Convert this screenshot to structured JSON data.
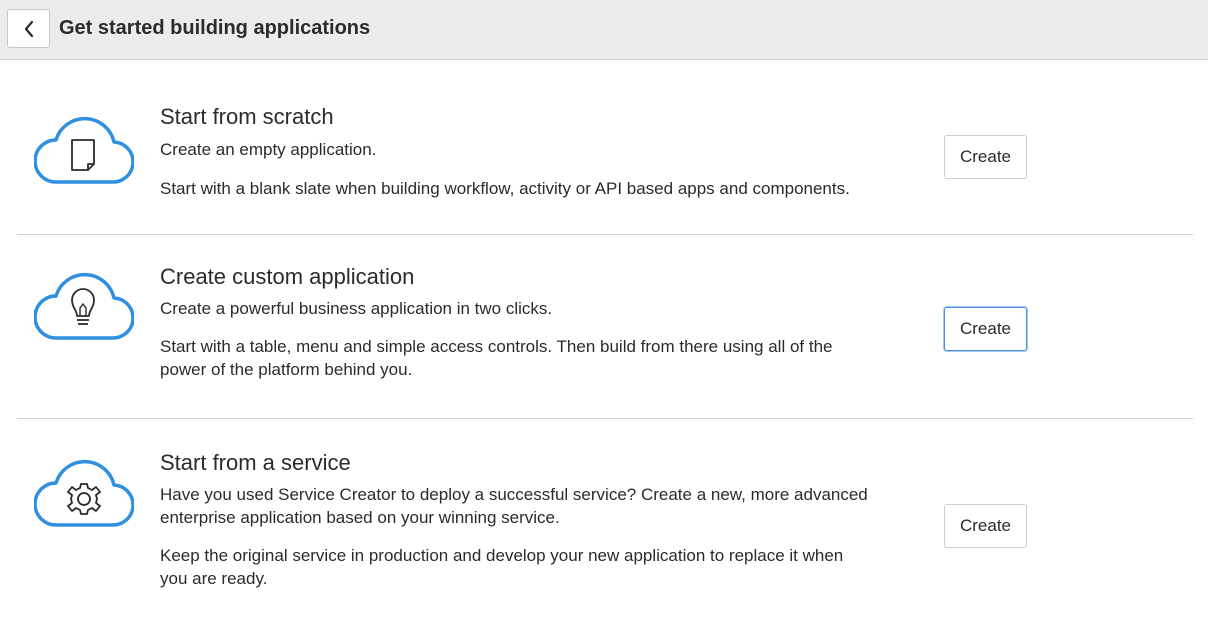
{
  "header": {
    "back_icon": "chevron-left-icon",
    "title": "Get started building applications"
  },
  "options": [
    {
      "icon": "cloud-document-icon",
      "title": "Start from scratch",
      "subtitle": "Create an empty application.",
      "description": "Start with a blank slate when building workflow, activity or API based apps and components.",
      "button_label": "Create"
    },
    {
      "icon": "cloud-lightbulb-icon",
      "title": "Create custom application",
      "subtitle": "Create a powerful business application in two clicks.",
      "description_line1": "Start with a table, menu and simple access controls. Then build from there using all of the",
      "description_line2": "power of the platform behind you.",
      "button_label": "Create"
    },
    {
      "icon": "cloud-gear-icon",
      "title": "Start from a service",
      "subtitle_line1": "Have you used Service Creator to deploy a successful service? Create a new, more advanced",
      "subtitle_line2": "enterprise application based on your winning service.",
      "description_line1": "Keep the original service in production and develop your new application to replace it when",
      "description_line2": "you are ready.",
      "button_label": "Create"
    }
  ],
  "colors": {
    "icon_accent": "#2f8fe0",
    "focus_border": "#4a90d9"
  }
}
